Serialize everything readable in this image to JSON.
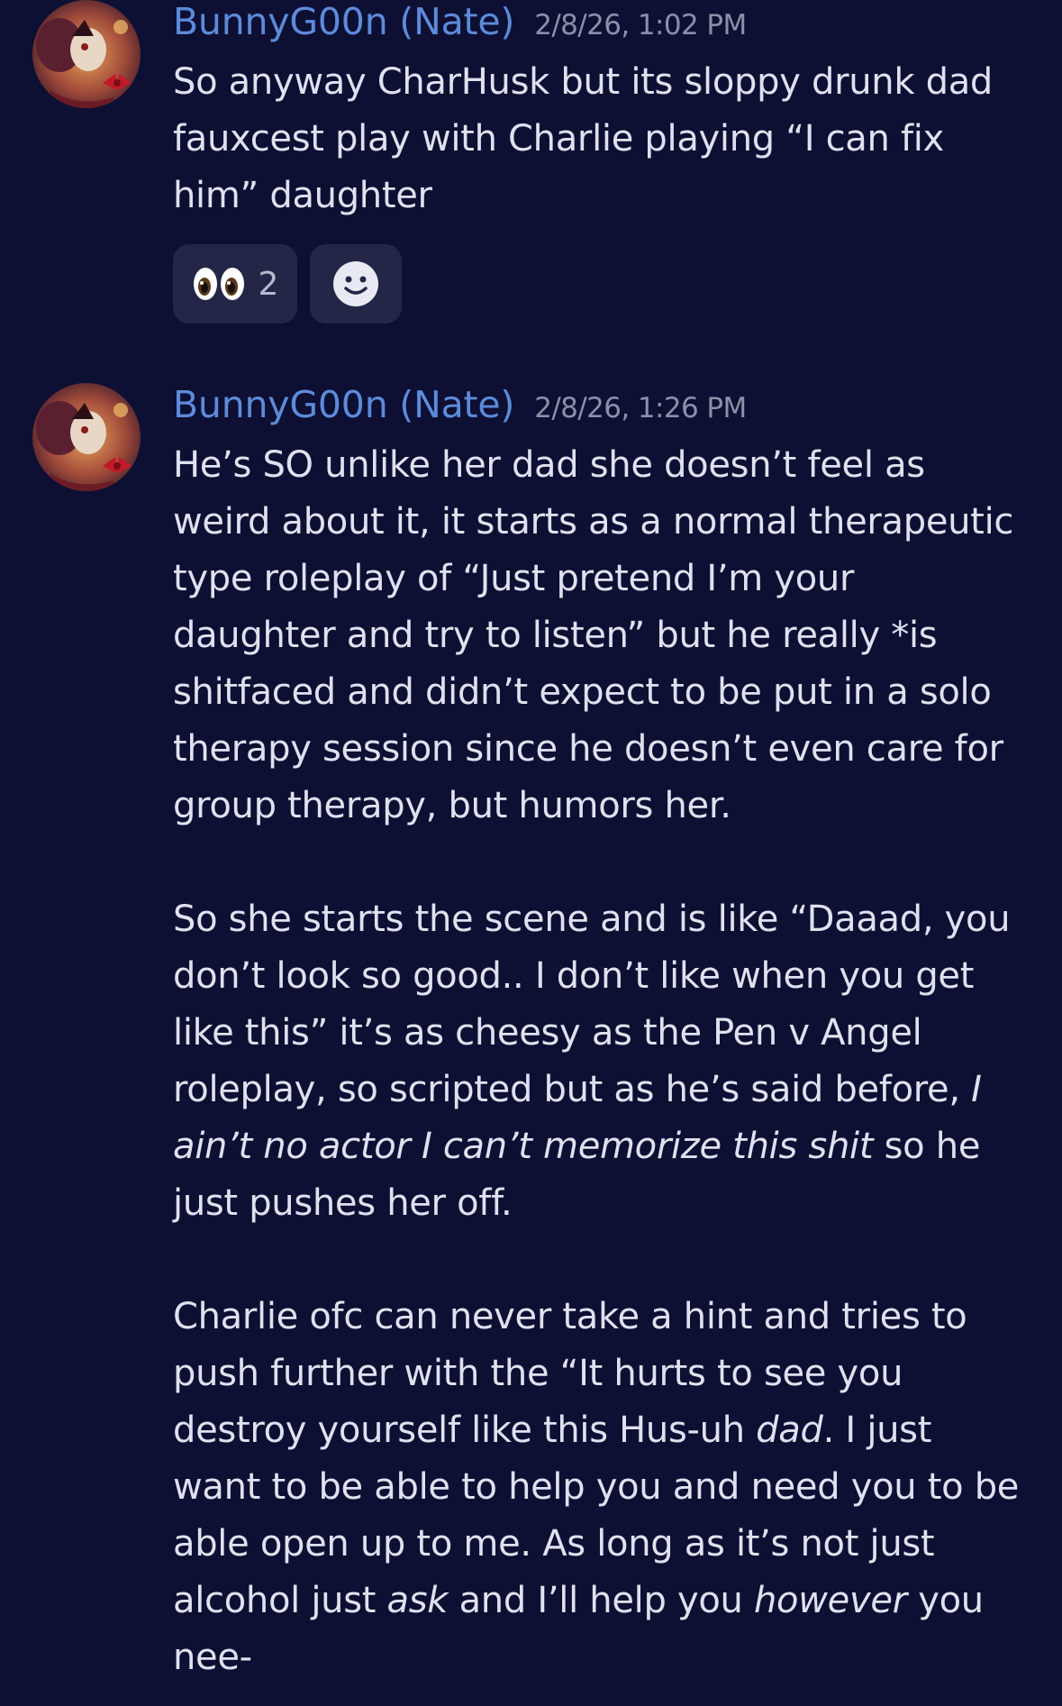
{
  "colors": {
    "background": "#0d0f33",
    "username": "#5d8bd9",
    "timestamp": "#8c8fa8",
    "text": "#dfe1f0",
    "reaction_bg": "#232647"
  },
  "messages": [
    {
      "author": "BunnyG00n (Nate)",
      "timestamp": "2/8/26, 1:02 PM",
      "avatar_icon": "avatar-icon",
      "text": "So anyway CharHusk but its sloppy drunk dad fauxcest play with Charlie playing “I can fix him” daughter",
      "reactions": [
        {
          "emoji": "eyes-emoji-icon",
          "count": "2"
        },
        {
          "emoji": "add-reaction-icon"
        }
      ]
    },
    {
      "author": "BunnyG00n (Nate)",
      "timestamp": "2/8/26, 1:26 PM",
      "avatar_icon": "avatar-icon",
      "paragraphs": [
        {
          "parts": [
            "He’s SO unlike her dad she doesn’t feel as weird about it, it starts as a normal therapeutic type roleplay of “Just pretend I’m your daughter and try to listen” but he really *is shitfaced and didn’t expect to be put in a solo therapy session since he doesn’t even care for group therapy, but humors her."
          ]
        },
        {
          "parts": [
            "So she starts the scene and is like “Daaad, you don’t look so good.. I don’t like when you get like this” it’s as cheesy as the Pen v Angel roleplay, so scripted but as he’s said before, ",
            "I ain’t no actor I can’t memorize this shit",
            " so he just pushes her off."
          ]
        },
        {
          "parts": [
            "Charlie ofc can never take a hint and tries to push further with the “It hurts to see you destroy yourself like this Hus-uh ",
            "dad",
            ". I just want to be able to help you and need you to be able open up to me. As long as it’s not just alcohol just ",
            "ask",
            " and I’ll help you ",
            "however",
            " you nee-"
          ]
        }
      ]
    }
  ]
}
